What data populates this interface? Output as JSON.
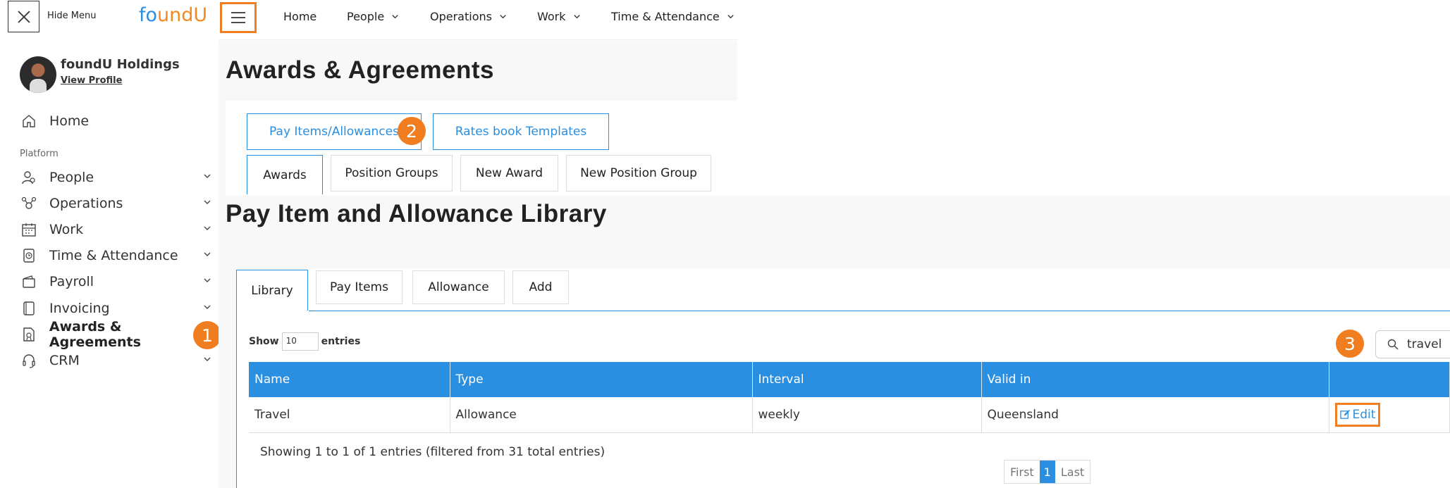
{
  "app": {
    "hide_menu": "Hide Menu",
    "logo_f": "f",
    "logo_o": "o",
    "logo_rest": "undU"
  },
  "profile": {
    "name": "foundU Holdings",
    "link": "View Profile"
  },
  "sidebar": {
    "home": "Home",
    "section": "Platform",
    "items": [
      {
        "label": "People",
        "icon": "people-icon"
      },
      {
        "label": "Operations",
        "icon": "operations-icon"
      },
      {
        "label": "Work",
        "icon": "calendar-icon"
      },
      {
        "label": "Time & Attendance",
        "icon": "clock-icon"
      },
      {
        "label": "Payroll",
        "icon": "wallet-icon"
      },
      {
        "label": "Invoicing",
        "icon": "invoice-icon"
      },
      {
        "label": "Awards & Agreements",
        "icon": "awards-icon"
      },
      {
        "label": "CRM",
        "icon": "headset-icon"
      }
    ]
  },
  "topnav": {
    "home": "Home",
    "people": "People",
    "operations": "Operations",
    "work": "Work",
    "time": "Time & Attendance"
  },
  "page": {
    "title": "Awards & Agreements",
    "btn_pay_items": "Pay Items/Allowances",
    "btn_rates_book": "Rates book Templates",
    "tabs": [
      "Awards",
      "Position Groups",
      "New Award",
      "New Position Group"
    ]
  },
  "library": {
    "title": "Pay Item and Allowance Library",
    "tabs": [
      "Library",
      "Pay Items",
      "Allowance",
      "Add"
    ],
    "show": "Show",
    "entries_value": "10",
    "entries": "entries",
    "search_value": "travel",
    "columns": [
      "Name",
      "Type",
      "Interval",
      "Valid in",
      ""
    ],
    "rows": [
      {
        "name": "Travel",
        "type": "Allowance",
        "interval": "weekly",
        "valid_in": "Queensland",
        "action": "Edit"
      }
    ],
    "showing": "Showing 1 to 1 of 1 entries (filtered from 31 total entries)",
    "pager": {
      "first": "First",
      "current": "1",
      "last": "Last"
    }
  },
  "markers": [
    "1",
    "2",
    "3"
  ],
  "colors": {
    "accent": "#2a8fe0",
    "highlight": "#f07d1f"
  }
}
